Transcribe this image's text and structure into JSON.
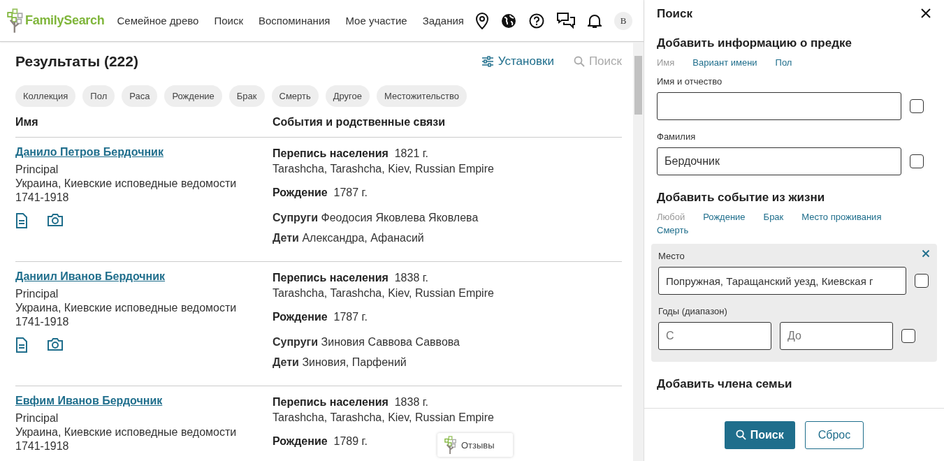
{
  "header": {
    "logo": "FamilySearch",
    "nav": [
      "Семейное древо",
      "Поиск",
      "Воспоминания",
      "Мое участие",
      "Задания"
    ],
    "avatar": "В"
  },
  "results": {
    "title": "Результаты (222)",
    "settings": "Установки",
    "search": "Поиск",
    "filters": [
      "Коллекция",
      "Пол",
      "Раса",
      "Рождение",
      "Брак",
      "Смерть",
      "Другое",
      "Местожительство"
    ],
    "columns": [
      "Имя",
      "События и родственные связи"
    ],
    "rows": [
      {
        "name": "Данило Петров Бердочник",
        "role": "Principal",
        "collection": "Украина, Киевские исповедные ведомости 1741-1918",
        "attachments": [
          {
            "kind": "document"
          },
          {
            "kind": "camera"
          }
        ],
        "events": [
          {
            "label": "Перепись населения",
            "value": "1821 г.",
            "place": "Tarashcha, Tarashcha, Kiev, Russian Empire"
          },
          {
            "label": "Рождение",
            "value": "1787 г."
          }
        ],
        "relations": [
          {
            "label": "Супруги",
            "value": "Феодосия Яковлева Яковлева"
          },
          {
            "label": "Дети",
            "value": "Александра, Афанасий"
          }
        ]
      },
      {
        "name": "Даниил Иванов Бердочник",
        "role": "Principal",
        "collection": "Украина, Киевские исповедные ведомости 1741-1918",
        "attachments": [
          {
            "kind": "document"
          },
          {
            "kind": "camera"
          }
        ],
        "events": [
          {
            "label": "Перепись населения",
            "value": "1838 г.",
            "place": "Tarashcha, Tarashcha, Kiev, Russian Empire"
          },
          {
            "label": "Рождение",
            "value": "1787 г."
          }
        ],
        "relations": [
          {
            "label": "Супруги",
            "value": "Зиновия Саввова Саввова"
          },
          {
            "label": "Дети",
            "value": "Зиновия, Парфений"
          }
        ]
      },
      {
        "name": "Евфим Иванов Бердочник",
        "role": "Principal",
        "collection": "Украина, Киевские исповедные ведомости 1741-1918",
        "attachments": [],
        "events": [
          {
            "label": "Перепись населения",
            "value": "1838 г.",
            "place": "Tarashcha, Tarashcha, Kiev, Russian Empire"
          },
          {
            "label": "Рождение",
            "value": "1789 г."
          }
        ],
        "relations": []
      }
    ]
  },
  "feedback": "Отзывы",
  "panel": {
    "title": "Поиск",
    "person": {
      "title": "Добавить информацию о предке",
      "tabs": [
        {
          "label": "Имя",
          "selected": true
        },
        {
          "label": "Вариант имени",
          "selected": false
        },
        {
          "label": "Пол",
          "selected": false
        }
      ],
      "fields": [
        {
          "label": "Имя и отчество",
          "checked": false
        },
        {
          "label": "Фамилия",
          "value": "Бердочник",
          "checked": false
        }
      ]
    },
    "event": {
      "title": "Добавить событие из жизни",
      "tabs": [
        {
          "label": "Любой",
          "selected": true
        },
        {
          "label": "Рождение",
          "selected": false
        },
        {
          "label": "Брак",
          "selected": false
        },
        {
          "label": "Место проживания",
          "selected": false
        },
        {
          "label": "Смерть",
          "selected": false
        }
      ],
      "place": {
        "label": "Место",
        "value": "Попружная, Таращанский уезд, Киевская г",
        "checked": false
      },
      "years": {
        "label": "Годы (диапазон)",
        "from_placeholder": "С",
        "to_placeholder": "До",
        "checked": false
      }
    },
    "family": {
      "title": "Добавить члена семьи"
    },
    "buttons": {
      "search": "Поиск",
      "reset": "Сброс"
    }
  }
}
